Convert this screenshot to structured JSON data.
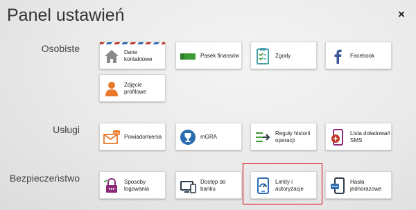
{
  "title": "Panel ustawień",
  "close_label": "×",
  "sections": {
    "personal": "Osobiste",
    "services": "Usługi",
    "security": "Bezpieczeństwo"
  },
  "tiles": {
    "contact": "Dane kontaktowe",
    "pasek": "Pasek finansów",
    "consents": "Zgody",
    "facebook": "Facebook",
    "photo": "Zdjęcie profilowe",
    "notifications": "Powiadomienia",
    "mgra": "mGRA",
    "history_rules": "Reguły historii operacji",
    "sms_topup": "Lista doładowań SMS",
    "login_methods": "Sposoby logowania",
    "bank_access": "Dostęp do banku",
    "limits": "Limity i autoryzacje",
    "otp": "Hasła jednorazowe"
  },
  "colors": {
    "orange": "#e8792b",
    "green": "#3e9b33",
    "blue": "#2b6cb0",
    "facebook": "#3b5998",
    "red": "#c0392b",
    "purple": "#8b2b7a",
    "dark": "#2a3a4a",
    "highlight": "#d40000"
  }
}
